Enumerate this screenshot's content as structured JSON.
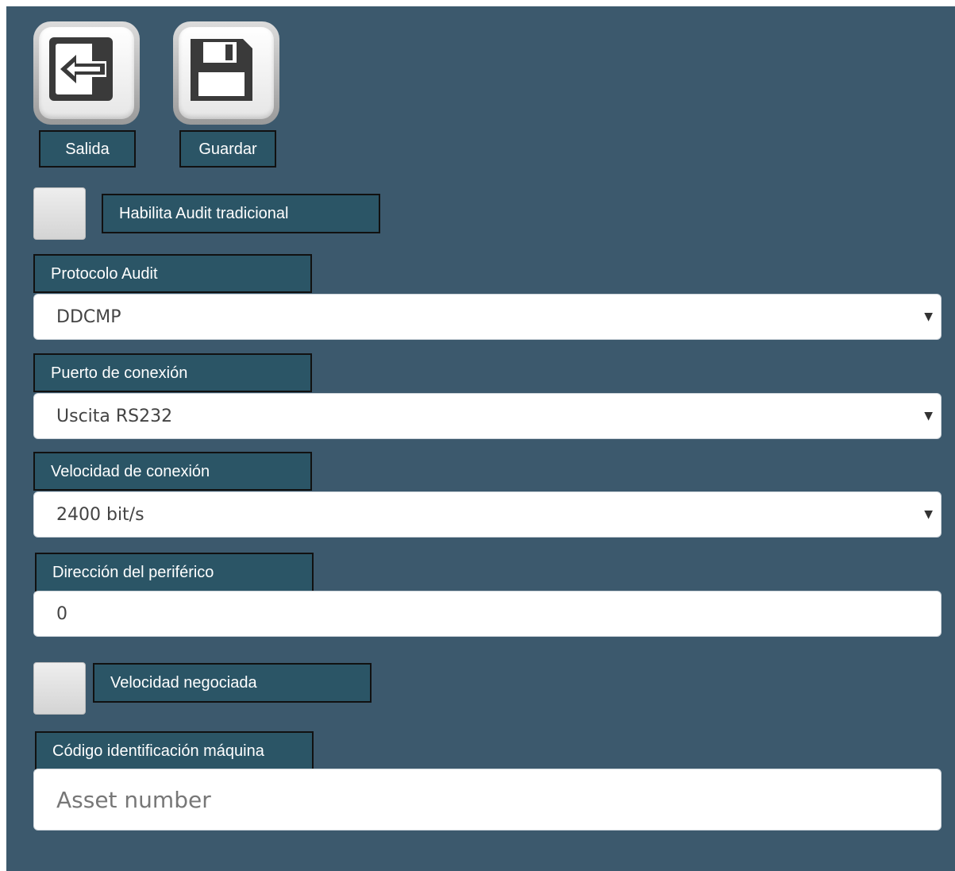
{
  "toolbar": {
    "exit_label": "Salida",
    "save_label": "Guardar"
  },
  "audit": {
    "enable_label": "Habilita Audit tradicional",
    "enable_checked": false
  },
  "protocol": {
    "label": "Protocolo Audit",
    "value": "DDCMP"
  },
  "port": {
    "label": "Puerto de conexión",
    "value": "Uscita RS232"
  },
  "speed": {
    "label": "Velocidad de conexión",
    "value": "2400 bit/s"
  },
  "address": {
    "label": "Dirección del periférico",
    "value": "0"
  },
  "negotiated": {
    "label": "Velocidad negociada",
    "checked": false
  },
  "machine_id": {
    "label": "Código identificación máquina",
    "placeholder": "Asset number",
    "value": ""
  },
  "icons": {
    "exit": "exit-arrow-icon",
    "save": "floppy-disk-icon",
    "dropdown": "dropdown-caret-icon"
  },
  "colors": {
    "panel_bg": "#3c596d",
    "label_bg": "#2b5566"
  }
}
